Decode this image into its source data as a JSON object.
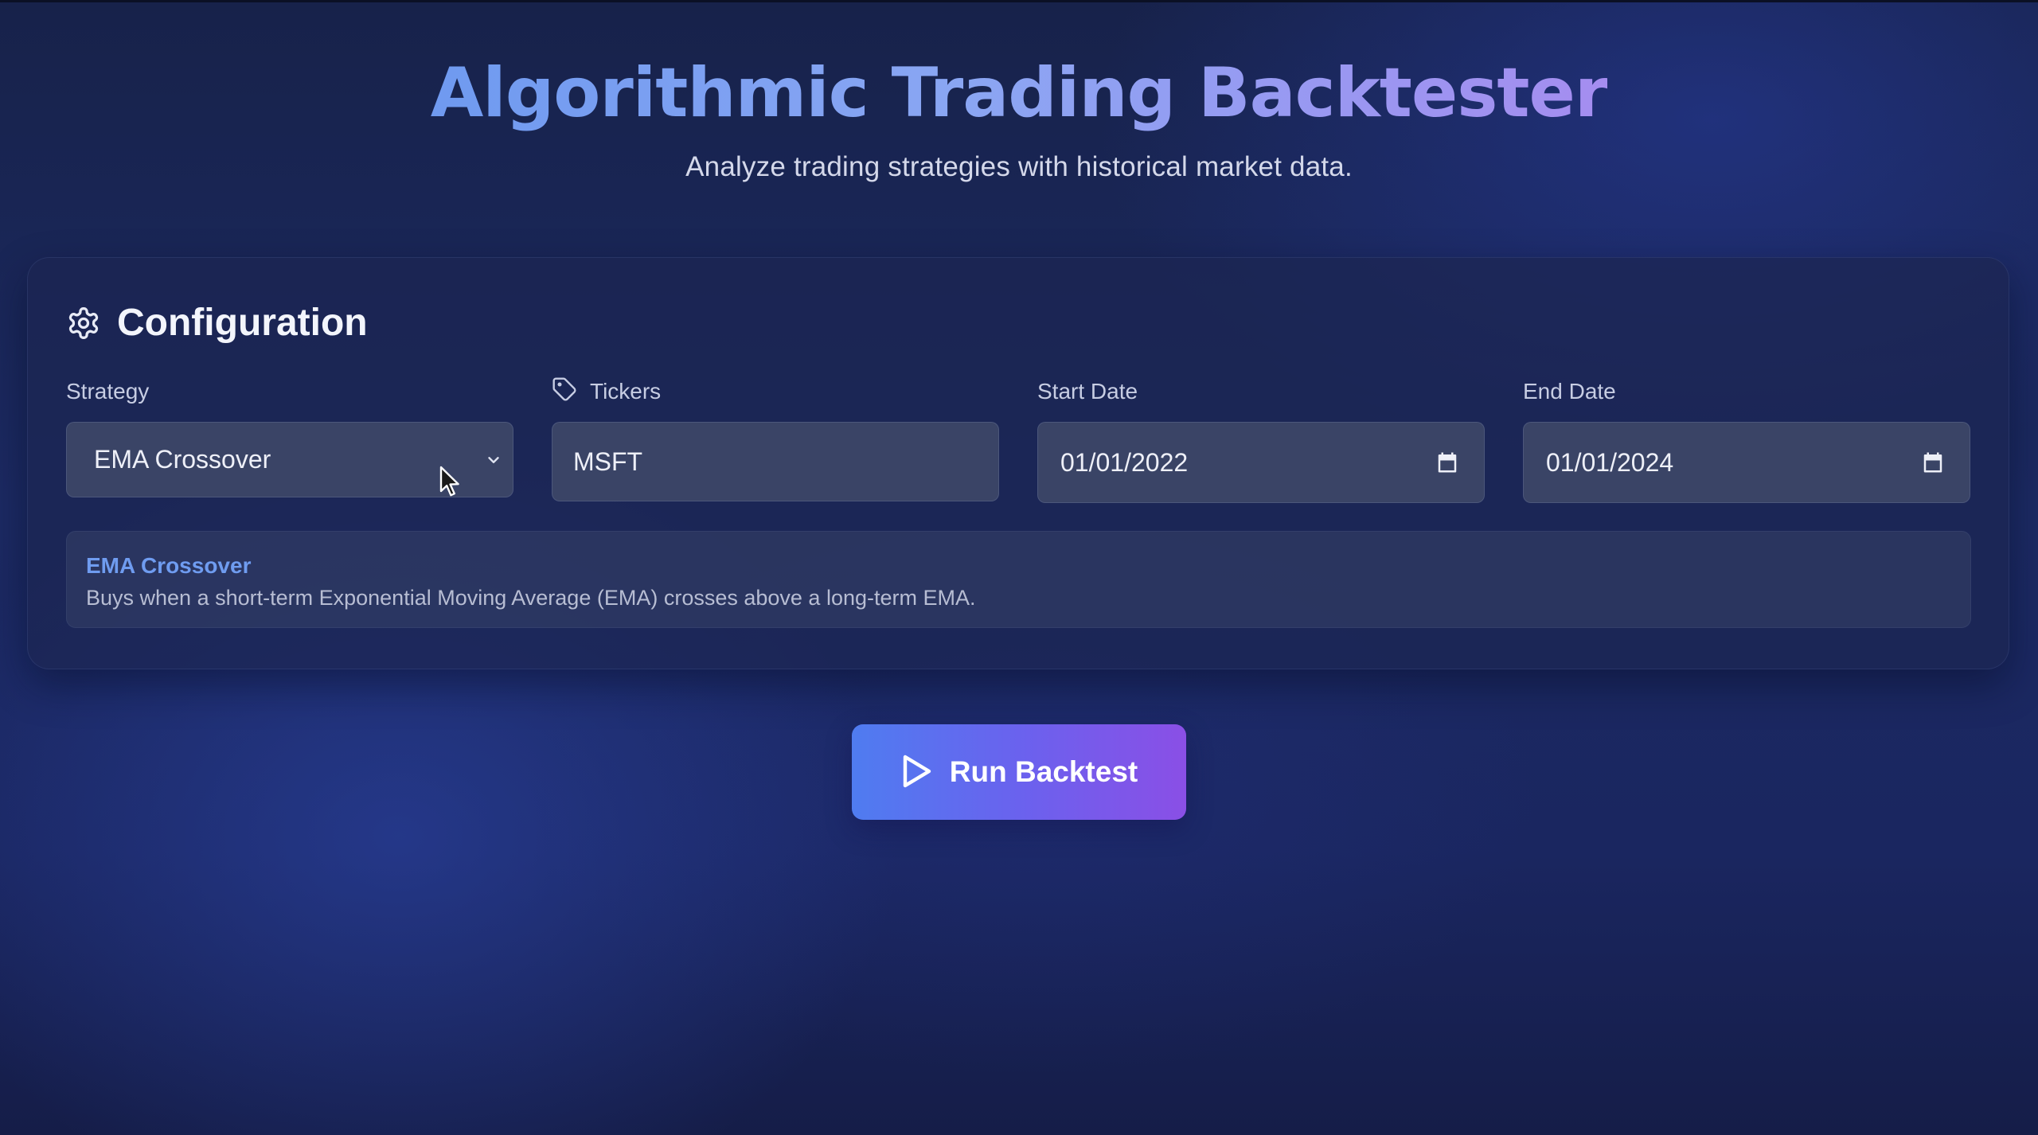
{
  "header": {
    "title": "Algorithmic Trading Backtester",
    "subtitle": "Analyze trading strategies with historical market data."
  },
  "config": {
    "title": "Configuration",
    "icon": "gear-icon",
    "strategy": {
      "label": "Strategy",
      "selected": "EMA Crossover",
      "icon": "chevron-down-icon"
    },
    "tickers": {
      "label": "Tickers",
      "icon": "tag-icon",
      "value": "MSFT"
    },
    "start_date": {
      "label": "Start Date",
      "value": "01/01/2022",
      "icon": "calendar-icon"
    },
    "end_date": {
      "label": "End Date",
      "value": "01/01/2024",
      "icon": "calendar-icon"
    },
    "description": {
      "title": "EMA Crossover",
      "text": "Buys when a short-term Exponential Moving Average (EMA) crosses above a long-term EMA."
    }
  },
  "run_button": {
    "label": "Run Backtest",
    "icon": "play-icon"
  },
  "colors": {
    "accent_blue": "#6f9cf0",
    "button_gradient_start": "#4f7cf0",
    "button_gradient_end": "#8a4fe6"
  }
}
